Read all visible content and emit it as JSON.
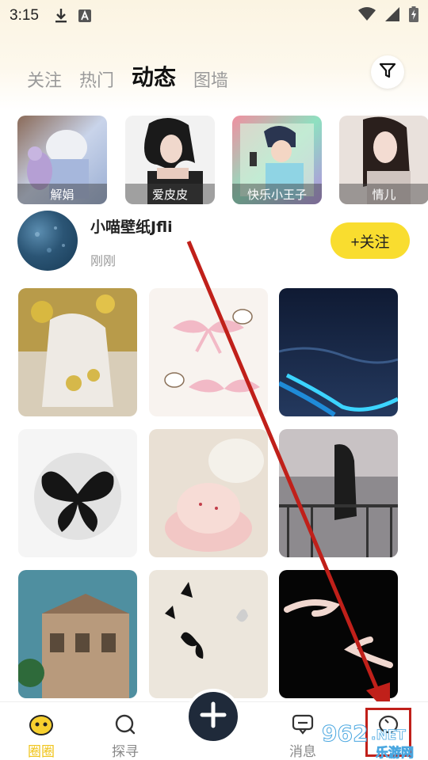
{
  "status_bar": {
    "time": "3:15"
  },
  "tabs": [
    {
      "label": "关注"
    },
    {
      "label": "热门"
    },
    {
      "label": "动态"
    },
    {
      "label": "图墙"
    }
  ],
  "stories": [
    {
      "label": "解娟"
    },
    {
      "label": "爱皮皮"
    },
    {
      "label": "快乐小王子"
    },
    {
      "label": "情儿"
    }
  ],
  "post": {
    "username": "小喵壁纸Jfli",
    "time": "刚刚",
    "follow_label": "+关注"
  },
  "bottom_nav": {
    "items": [
      {
        "label": "圈圈"
      },
      {
        "label": "探寻"
      },
      {
        "label": "消息"
      }
    ]
  },
  "watermark": {
    "text_top": "962",
    "text_net": ".NET",
    "text_bottom": "乐游网"
  },
  "colors": {
    "accent_yellow": "#f9dd2f",
    "annotation_red": "#c0201a"
  }
}
